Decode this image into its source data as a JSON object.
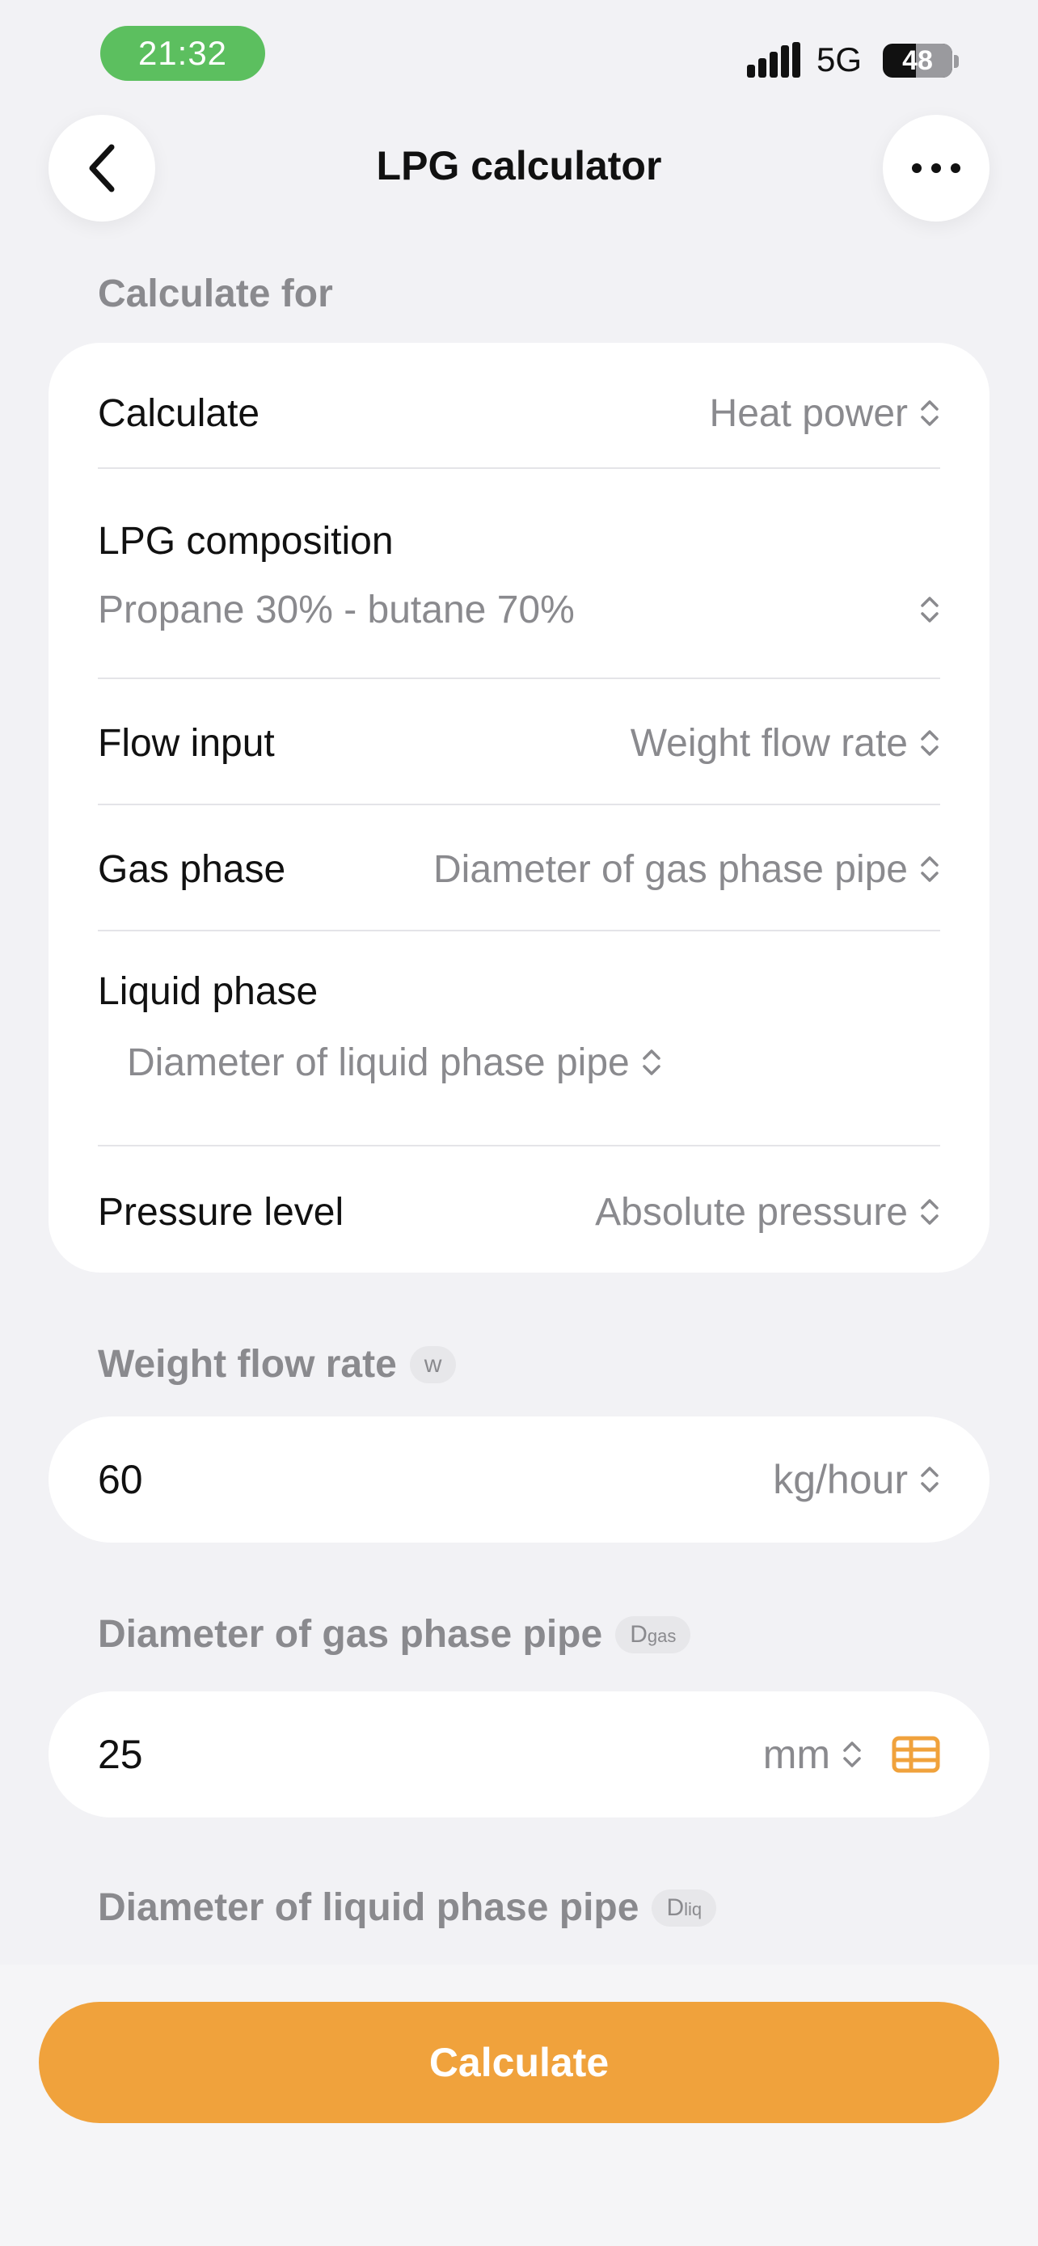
{
  "status_bar": {
    "time": "21:32",
    "network": "5G",
    "battery": "48"
  },
  "nav": {
    "title": "LPG calculator",
    "icons": [
      "back-chevron-icon",
      "more-dots-icon"
    ]
  },
  "calculate_for": {
    "section_title": "Calculate for",
    "rows": [
      {
        "label": "Calculate",
        "value": "Heat power"
      },
      {
        "label": "LPG composition",
        "value": "Propane 30% - butane 70%"
      },
      {
        "label": "Flow input",
        "value": "Weight flow rate"
      },
      {
        "label": "Gas phase",
        "value": "Diameter of gas phase pipe"
      },
      {
        "label": "Liquid phase",
        "value": "Diameter of liquid phase pipe"
      },
      {
        "label": "Pressure level",
        "value": "Absolute pressure"
      }
    ]
  },
  "weight_flow": {
    "title": "Weight flow rate",
    "symbol": "w",
    "value": "60",
    "unit": "kg/hour"
  },
  "gas_pipe": {
    "title": "Diameter of gas phase pipe",
    "symbol": "D",
    "symbol_sub": "gas",
    "value": "25",
    "unit": "mm",
    "icon": "table-icon"
  },
  "liquid_pipe": {
    "title": "Diameter of liquid phase pipe",
    "symbol": "D",
    "symbol_sub": "liq"
  },
  "actions": {
    "calculate_label": "Calculate"
  },
  "colors": {
    "accent": "#f0a23c",
    "status_green": "#5cbf5f",
    "background": "#f2f2f5"
  }
}
